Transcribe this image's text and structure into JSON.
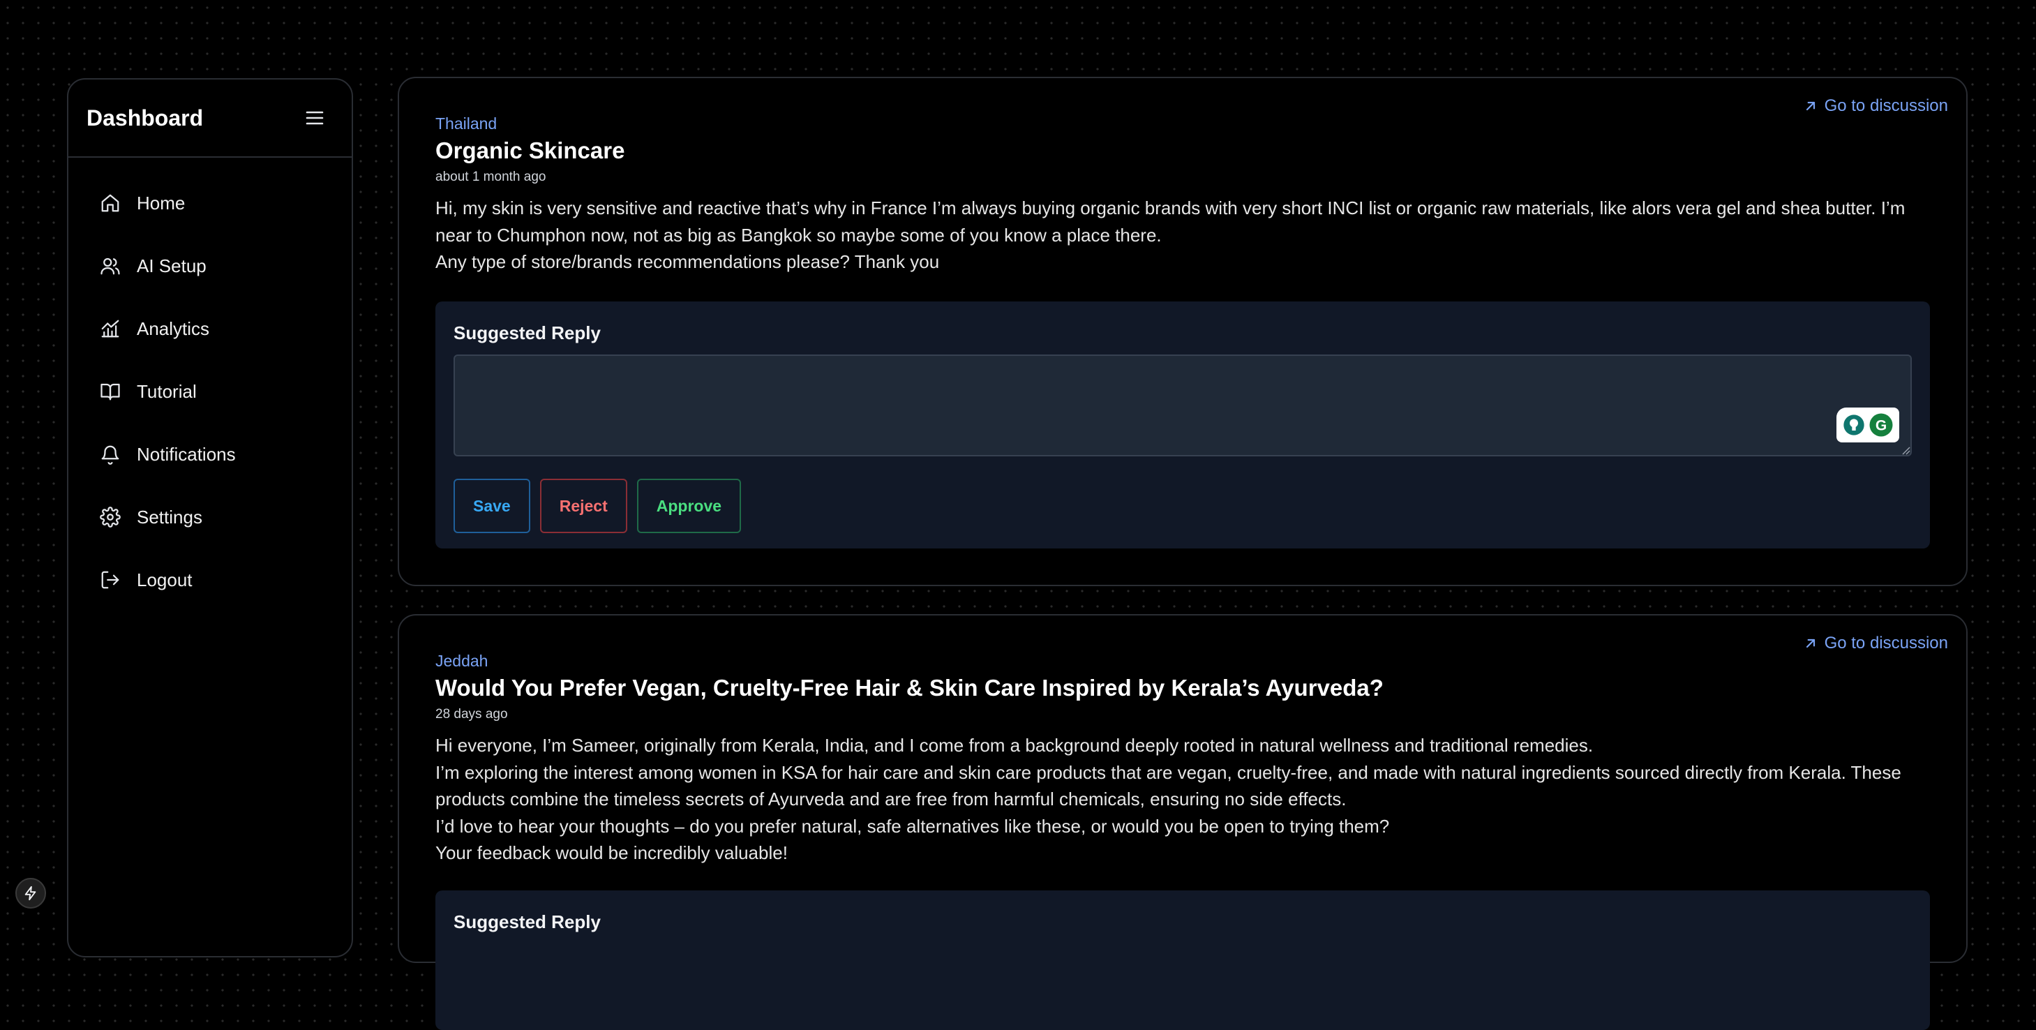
{
  "sidebar": {
    "brand": "Dashboard",
    "items": [
      {
        "label": "Home",
        "icon": "home-icon"
      },
      {
        "label": "AI Setup",
        "icon": "users-icon"
      },
      {
        "label": "Analytics",
        "icon": "analytics-icon"
      },
      {
        "label": "Tutorial",
        "icon": "book-icon"
      },
      {
        "label": "Notifications",
        "icon": "bell-icon"
      },
      {
        "label": "Settings",
        "icon": "gear-icon"
      },
      {
        "label": "Logout",
        "icon": "logout-icon"
      }
    ]
  },
  "posts": [
    {
      "goto_label": "Go to discussion",
      "location": "Thailand",
      "title": "Organic Skincare",
      "age": "about 1 month ago",
      "body": [
        "Hi, my skin is very sensitive and reactive that’s why in France I’m always buying organic brands with very short INCI list or organic raw materials, like alors vera gel and shea butter. I’m near to Chumphon now, not as big as Bangkok so maybe some of you know a place there.",
        "Any type of store/brands recommendations please? Thank you"
      ],
      "reply": {
        "title": "Suggested Reply",
        "value": "",
        "save_label": "Save",
        "reject_label": "Reject",
        "approve_label": "Approve"
      }
    },
    {
      "goto_label": "Go to discussion",
      "location": "Jeddah",
      "title": "Would You Prefer Vegan, Cruelty-Free Hair & Skin Care Inspired by Kerala’s Ayurveda?",
      "age": "28 days ago",
      "body": [
        "Hi everyone, I’m Sameer, originally from Kerala, India, and I come from a background deeply rooted in natural wellness and traditional remedies.",
        "I’m exploring the interest among women in KSA for hair care and skin care products that are vegan, cruelty-free, and made with natural ingredients sourced directly from Kerala. These products combine the timeless secrets of Ayurveda and are free from harmful chemicals, ensuring no side effects.",
        "I’d love to hear your thoughts – do you prefer natural, safe alternatives like these, or would you be open to trying them?",
        "Your feedback would be incredibly valuable!"
      ],
      "reply": {
        "title": "Suggested Reply"
      }
    }
  ],
  "colors": {
    "accent_link": "#7aa3f5",
    "save": "#38a9f5",
    "reject": "#f87171",
    "approve": "#4ade80",
    "panel": "#111827"
  }
}
